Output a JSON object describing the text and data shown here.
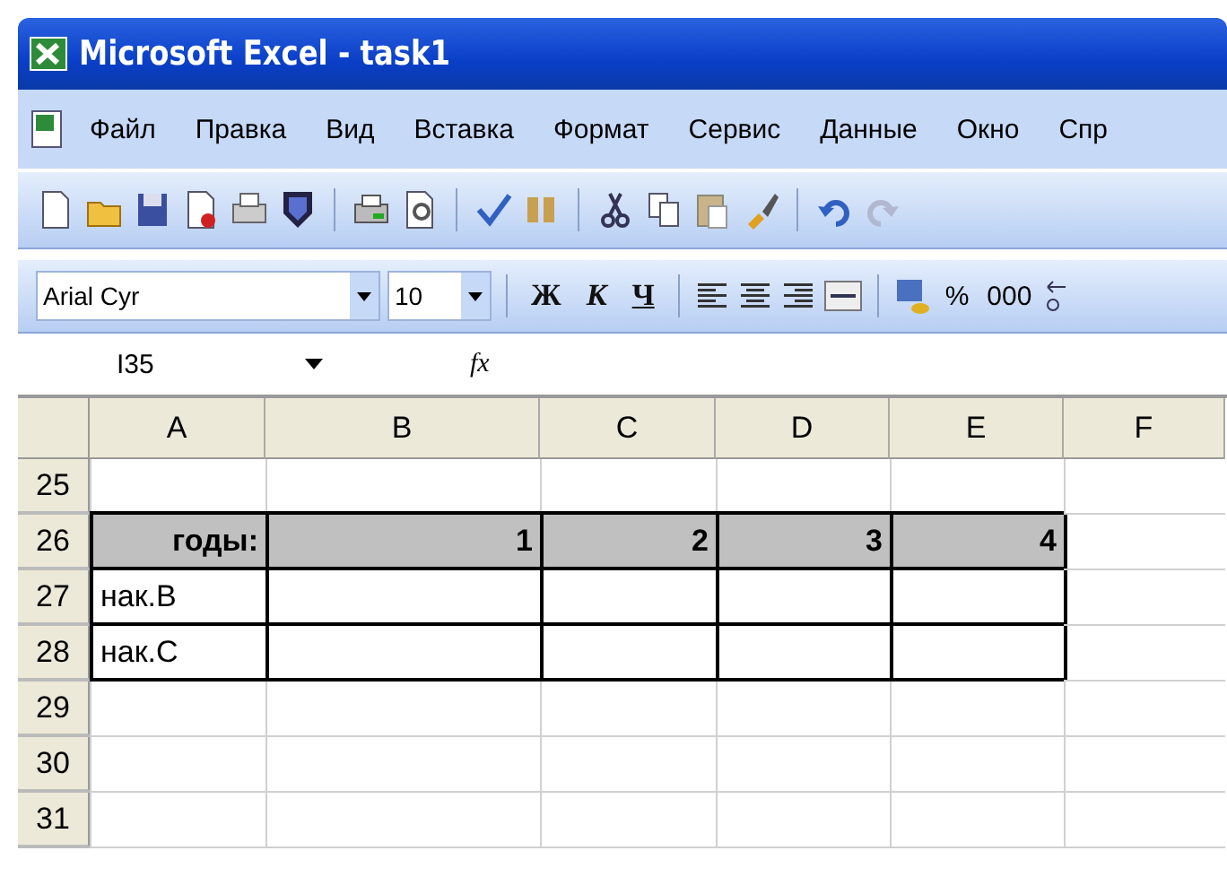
{
  "window": {
    "title": "Microsoft Excel - task1"
  },
  "menu": [
    "Файл",
    "Правка",
    "Вид",
    "Вставка",
    "Формат",
    "Сервис",
    "Данные",
    "Окно",
    "Спр"
  ],
  "formatting": {
    "font": "Arial Cyr",
    "size": "10",
    "style_buttons": [
      "Ж",
      "К",
      "Ч"
    ],
    "number_buttons": [
      "%",
      "000"
    ]
  },
  "formula_bar": {
    "name_box": "I35",
    "fx": "fx"
  },
  "columns": [
    "A",
    "B",
    "C",
    "D",
    "E",
    "F"
  ],
  "rows": [
    {
      "number": "25",
      "shaded": false,
      "bordered": false,
      "cells": [
        "",
        "",
        "",
        "",
        "",
        ""
      ]
    },
    {
      "number": "26",
      "shaded": true,
      "bordered": true,
      "cells": [
        "годы:",
        "1",
        "2",
        "3",
        "4",
        ""
      ]
    },
    {
      "number": "27",
      "shaded": false,
      "bordered": true,
      "cells": [
        "нак.B",
        "",
        "",
        "",
        "",
        ""
      ]
    },
    {
      "number": "28",
      "shaded": false,
      "bordered": true,
      "cells": [
        "нак.C",
        "",
        "",
        "",
        "",
        ""
      ]
    },
    {
      "number": "29",
      "shaded": false,
      "bordered": false,
      "cells": [
        "",
        "",
        "",
        "",
        "",
        ""
      ]
    },
    {
      "number": "30",
      "shaded": false,
      "bordered": false,
      "cells": [
        "",
        "",
        "",
        "",
        "",
        ""
      ]
    },
    {
      "number": "31",
      "shaded": false,
      "bordered": false,
      "cells": [
        "",
        "",
        "",
        "",
        "",
        ""
      ]
    }
  ]
}
